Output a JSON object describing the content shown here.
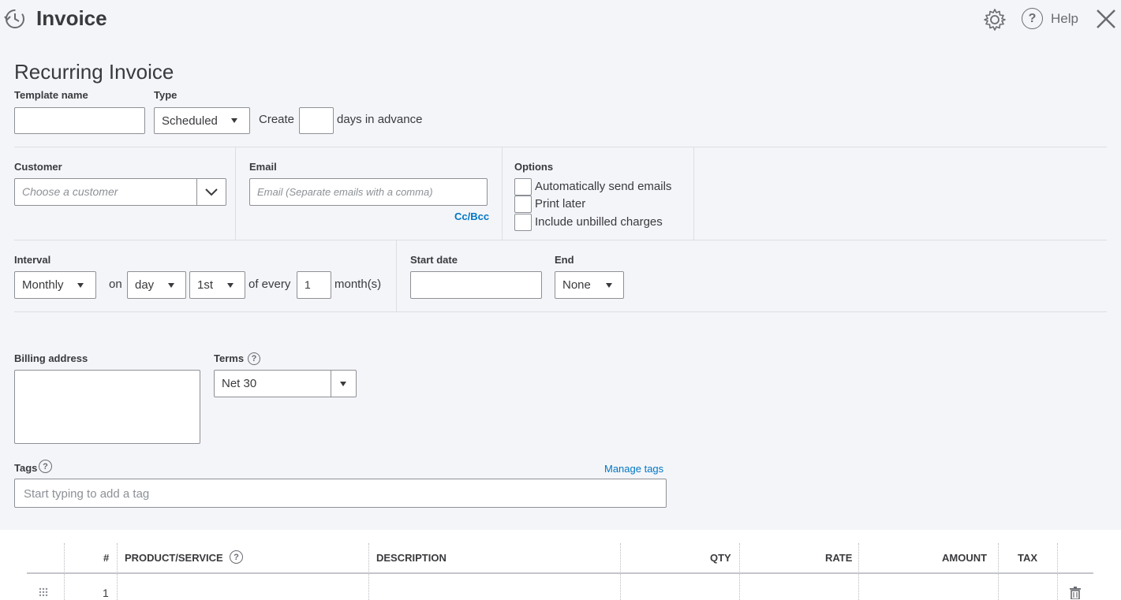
{
  "header": {
    "title": "Invoice",
    "help_label": "Help",
    "icons": [
      "history-icon",
      "gear-icon",
      "help-icon",
      "close-icon"
    ]
  },
  "page_title": "Recurring Invoice",
  "template": {
    "name_label": "Template name",
    "name_value": "",
    "type_label": "Type",
    "type_value": "Scheduled",
    "create_label": "Create",
    "days_value": "",
    "days_suffix": "days in advance"
  },
  "customer": {
    "label": "Customer",
    "placeholder": "Choose a customer"
  },
  "email": {
    "label": "Email",
    "placeholder": "Email (Separate emails with a comma)",
    "cc_bcc": "Cc/Bcc"
  },
  "options": {
    "label": "Options",
    "items": [
      {
        "label": "Automatically send emails",
        "checked": false
      },
      {
        "label": "Print later",
        "checked": false
      },
      {
        "label": "Include unbilled charges",
        "checked": false
      }
    ]
  },
  "interval": {
    "label": "Interval",
    "frequency": "Monthly",
    "on_label": "on",
    "unit": "day",
    "day": "1st",
    "of_every_label": "of every",
    "every_value": "1",
    "suffix": "month(s)"
  },
  "start_date": {
    "label": "Start date",
    "value": ""
  },
  "end": {
    "label": "End",
    "value": "None"
  },
  "billing": {
    "label": "Billing address",
    "value": ""
  },
  "terms": {
    "label": "Terms",
    "value": "Net 30"
  },
  "tags": {
    "label": "Tags",
    "manage_label": "Manage tags",
    "placeholder": "Start typing to add a tag"
  },
  "table": {
    "columns": [
      "#",
      "PRODUCT/SERVICE",
      "DESCRIPTION",
      "QTY",
      "RATE",
      "AMOUNT",
      "TAX"
    ],
    "rows": [
      {
        "num": "1",
        "product": "",
        "description": "",
        "qty": "",
        "rate": "",
        "amount": "",
        "tax": ""
      }
    ]
  },
  "colors": {
    "accent": "#0077c5",
    "text": "#393a3d",
    "background": "#f4f5f8"
  }
}
